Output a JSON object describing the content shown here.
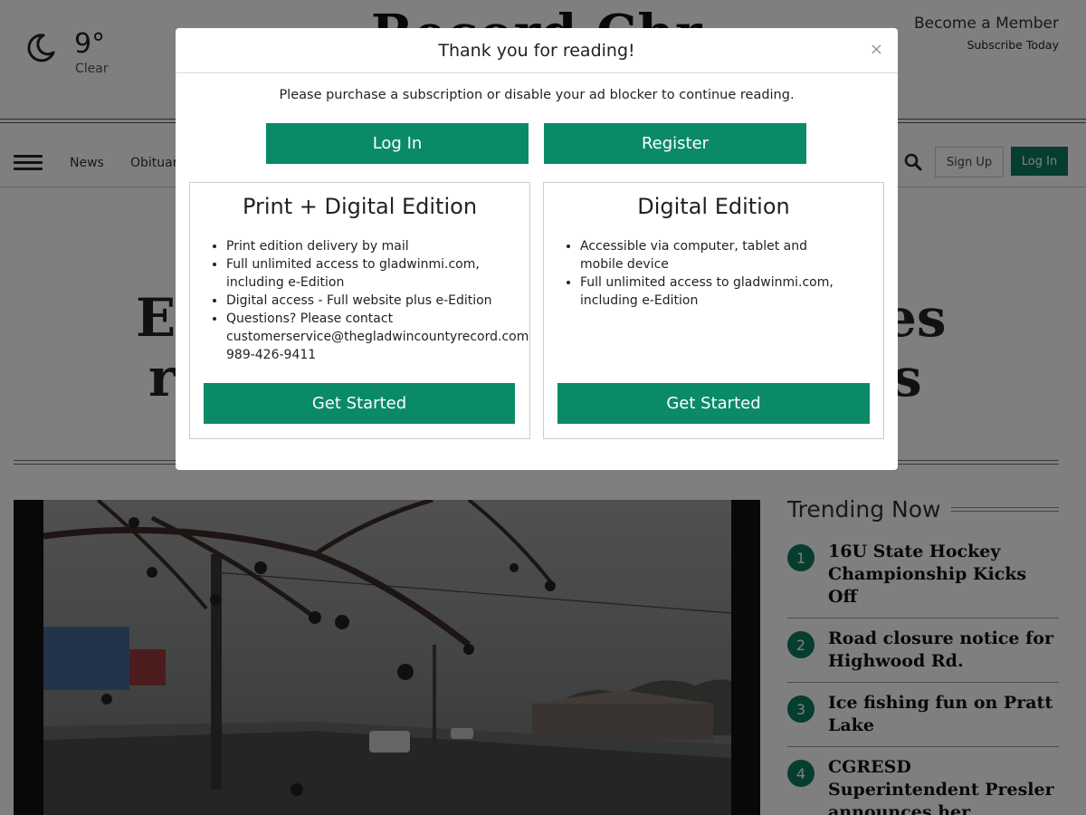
{
  "weather": {
    "temperature": "9°",
    "condition": "Clear",
    "icon": "moon-icon"
  },
  "masthead": {
    "title": "Record Chr"
  },
  "header": {
    "become_member": "Become a Member",
    "subscribe": "Subscribe Today"
  },
  "nav": {
    "items": [
      "News",
      "Obituar"
    ],
    "search_icon": "search-icon",
    "signup_label": "Sign Up",
    "login_label": "Log In"
  },
  "article": {
    "headline_parts": [
      "E",
      "es",
      "r",
      "s"
    ]
  },
  "trending": {
    "title": "Trending Now",
    "items": [
      {
        "num": "1",
        "text": "16U State Hockey Championship Kicks Off"
      },
      {
        "num": "2",
        "text": "Road closure notice for Highwood Rd."
      },
      {
        "num": "3",
        "text": "Ice fishing fun on Pratt Lake"
      },
      {
        "num": "4",
        "text": "CGRESD Superintendent Presler announces her retirement"
      }
    ]
  },
  "modal": {
    "title": "Thank you for reading!",
    "close": "×",
    "message": "Please purchase a subscription or disable your ad blocker to continue reading.",
    "login_label": "Log In",
    "register_label": "Register",
    "plans": [
      {
        "title": "Print + Digital Edition",
        "features": [
          "Print edition delivery by mail",
          "Full unlimited access to gladwinmi.com, including e-Edition",
          "Digital access - Full website plus e-Edition",
          "Questions? Please contact customerservice@thegladwincountyrecord.com or 989-426-9411"
        ],
        "cta": "Get Started"
      },
      {
        "title": "Digital Edition",
        "features": [
          "Accessible via computer, tablet and mobile device",
          "Full unlimited access to gladwinmi.com, including e-Edition"
        ],
        "cta": "Get Started"
      }
    ]
  },
  "colors": {
    "brand_green": "#0b8a68",
    "overlay": "rgba(0,0,0,0.5)"
  }
}
